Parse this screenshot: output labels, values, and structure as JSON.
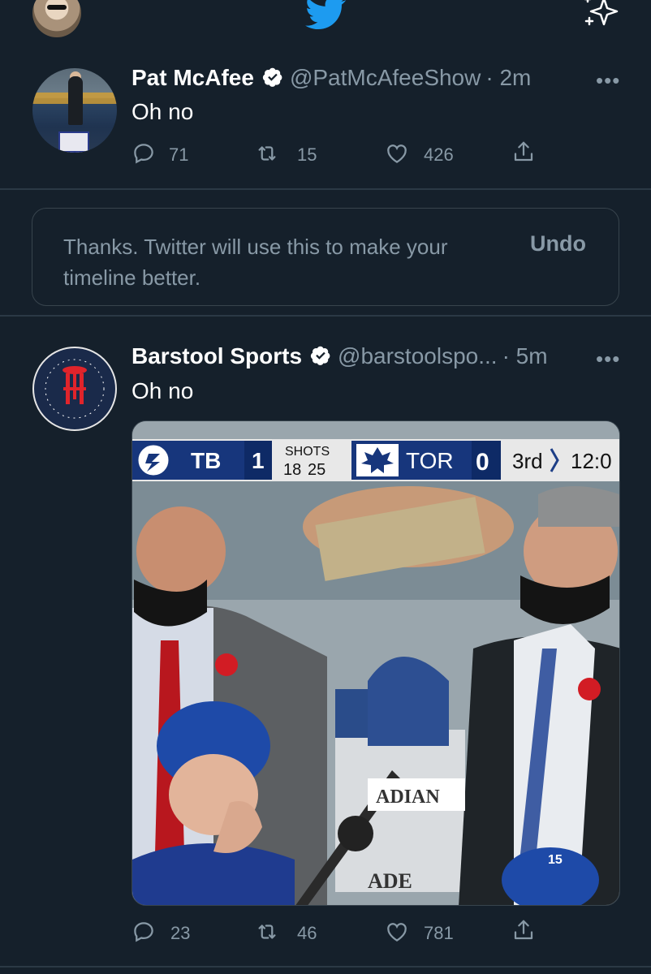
{
  "header": {
    "profile_icon": "user-avatar",
    "logo_icon": "twitter-bird-icon",
    "sparkle_icon": "sparkle-icon"
  },
  "tweets": [
    {
      "name": "Pat McAfee",
      "handle": "@PatMcAfeeShow",
      "time": "· 2m",
      "text": "Oh no",
      "replies": "71",
      "retweets": "15",
      "likes": "426"
    },
    {
      "name": "Barstool Sports",
      "handle": "@barstoolspo...",
      "time": "· 5m",
      "text": "Oh no",
      "replies": "23",
      "retweets": "46",
      "likes": "781",
      "media": {
        "team_away": "TB",
        "score_away": "1",
        "shots_label": "SHOTS",
        "shots_away": "18",
        "shots_home": "25",
        "team_home": "TOR",
        "score_home": "0",
        "period": "3rd",
        "clock": "12:0",
        "board_text_1": "ADIAN",
        "board_text_2": "ADE",
        "jersey_number": "15"
      }
    }
  ],
  "notice": {
    "text": "Thanks. Twitter will use this to make your timeline better.",
    "undo_label": "Undo"
  },
  "more_label": "•••",
  "colors": {
    "background": "#15202b",
    "muted": "#8899a6",
    "twitter_blue": "#1d9bf0",
    "divider": "#2b3945"
  }
}
